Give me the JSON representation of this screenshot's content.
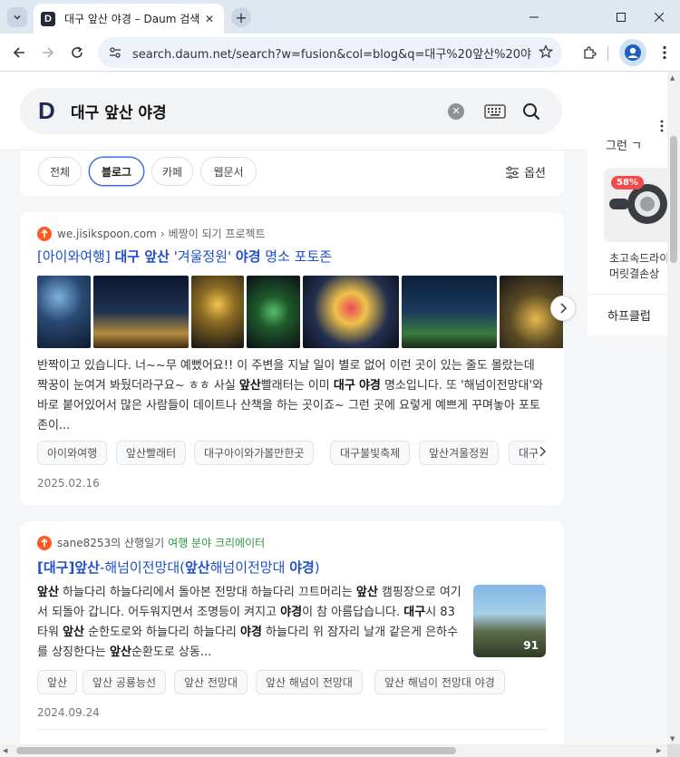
{
  "browser": {
    "tab_title": "대구 앞산 야경 – Daum 검색",
    "url": "search.daum.net/search?w=fusion&col=blog&q=대구%20앞산%20야경&D..."
  },
  "search": {
    "logo": "D",
    "query": "대구 앞산 야경"
  },
  "filters": {
    "chips": [
      "전체",
      "블로그",
      "카페",
      "웹문서"
    ],
    "active": "블로그",
    "options_label": "옵션"
  },
  "results": [
    {
      "source": "we.jisikspoon.com",
      "source_sub": "베짱이 되기 프로젝트",
      "title_parts": [
        "[아이와여행] ",
        "대구 앞산",
        " '겨울정원' ",
        "야경",
        " 명소 포토존"
      ],
      "snippet_parts": [
        "반짝이고 있습니다. 너~~무 예뻤어요!! 이 주변을 지날 일이 별로 없어 이런 곳이 있는 줄도 몰랐는데 짝꿍이 눈여겨 봐뒀더라구요~ ㅎㅎ 사실 ",
        "앞산",
        "빨래터는 이미 ",
        "대구",
        " ",
        "야경",
        " 명소입니다. 또 '해넘이전망대'와 바로 붙어있어서 많은 사람들이 데이트나 산책을 하는 곳이죠~ 그런 곳에 요렇게 예쁘게 꾸며놓아 포토존이..."
      ],
      "tags": [
        "아이와여행",
        "앞산빨래터",
        "대구아이와가볼만한곳",
        "대구불빛축제",
        "앞산겨울정원",
        "대구"
      ],
      "date": "2025.02.16"
    },
    {
      "source": "sane8253의 산행일기",
      "source_badge": "여행 분야 크리에이터",
      "title_parts": [
        "[대구]",
        "앞산",
        "-해넘이전망대(",
        "앞산",
        "해넘이전망대 ",
        "야경",
        ")"
      ],
      "snippet_parts": [
        "앞산",
        " 하늘다리 하늘다리에서 돌아본 전망대 하늘다리 끄트머리는 ",
        "앞산",
        " 캠핑장으로 여기서 되돌아 갑니다. 어두워지면서 조명등이 켜지고 ",
        "야경",
        "이 참 아름답습니다. ",
        "대구",
        "시 83타워 ",
        "앞산",
        " 순한도로와 하늘다리 하늘다리 ",
        "야경",
        " 하늘다리 위 잠자리 날개 같은게 은하수를 상징한다는 ",
        "앞산",
        "순환도로 상동..."
      ],
      "image_count": "91",
      "tags": [
        "앞산",
        "앞산 공룡능선",
        "앞산 전망대",
        "앞산 해넘이 전망대",
        "앞산 해넘이 전망대 야경"
      ],
      "date": "2024.09.24"
    }
  ],
  "side_ad": {
    "header": "그런 ㄱ",
    "discount": "58%",
    "product_line1": "초고속드라이",
    "product_line2": "머릿결손상",
    "footer": "하프클럽"
  }
}
